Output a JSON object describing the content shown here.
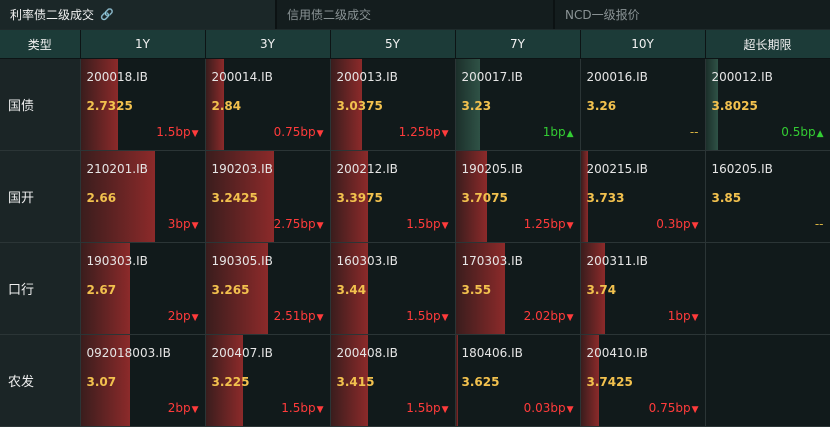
{
  "tabs": [
    {
      "label": "利率债二级成交",
      "active": true
    },
    {
      "label": "信用债二级成交",
      "active": false
    },
    {
      "label": "NCD一级报价",
      "active": false
    }
  ],
  "columns": [
    "类型",
    "1Y",
    "3Y",
    "5Y",
    "7Y",
    "10Y",
    "超长期限"
  ],
  "rows": [
    {
      "type": "国债",
      "cells": [
        {
          "code": "200018.IB",
          "yield": "2.7325",
          "change": "1.5bp",
          "dir": "down",
          "bar": 0.3
        },
        {
          "code": "200014.IB",
          "yield": "2.84",
          "change": "0.75bp",
          "dir": "down",
          "bar": 0.15
        },
        {
          "code": "200013.IB",
          "yield": "3.0375",
          "change": "1.25bp",
          "dir": "down",
          "bar": 0.25
        },
        {
          "code": "200017.IB",
          "yield": "3.23",
          "change": "1bp",
          "dir": "up",
          "bar": 0.2
        },
        {
          "code": "200016.IB",
          "yield": "3.26",
          "change": "--",
          "dir": "none",
          "bar": 0
        },
        {
          "code": "200012.IB",
          "yield": "3.8025",
          "change": "0.5bp",
          "dir": "up",
          "bar": 0.1
        }
      ]
    },
    {
      "type": "国开",
      "cells": [
        {
          "code": "210201.IB",
          "yield": "2.66",
          "change": "3bp",
          "dir": "down",
          "bar": 0.6
        },
        {
          "code": "190203.IB",
          "yield": "3.2425",
          "change": "2.75bp",
          "dir": "down",
          "bar": 0.55
        },
        {
          "code": "200212.IB",
          "yield": "3.3975",
          "change": "1.5bp",
          "dir": "down",
          "bar": 0.3
        },
        {
          "code": "190205.IB",
          "yield": "3.7075",
          "change": "1.25bp",
          "dir": "down",
          "bar": 0.25
        },
        {
          "code": "200215.IB",
          "yield": "3.733",
          "change": "0.3bp",
          "dir": "down",
          "bar": 0.06
        },
        {
          "code": "160205.IB",
          "yield": "3.85",
          "change": "--",
          "dir": "none",
          "bar": 0
        }
      ]
    },
    {
      "type": "口行",
      "cells": [
        {
          "code": "190303.IB",
          "yield": "2.67",
          "change": "2bp",
          "dir": "down",
          "bar": 0.4
        },
        {
          "code": "190305.IB",
          "yield": "3.265",
          "change": "2.51bp",
          "dir": "down",
          "bar": 0.5
        },
        {
          "code": "160303.IB",
          "yield": "3.44",
          "change": "1.5bp",
          "dir": "down",
          "bar": 0.3
        },
        {
          "code": "170303.IB",
          "yield": "3.55",
          "change": "2.02bp",
          "dir": "down",
          "bar": 0.4
        },
        {
          "code": "200311.IB",
          "yield": "3.74",
          "change": "1bp",
          "dir": "down",
          "bar": 0.2
        },
        null
      ]
    },
    {
      "type": "农发",
      "cells": [
        {
          "code": "092018003.IB",
          "yield": "3.07",
          "change": "2bp",
          "dir": "down",
          "bar": 0.4
        },
        {
          "code": "200407.IB",
          "yield": "3.225",
          "change": "1.5bp",
          "dir": "down",
          "bar": 0.3
        },
        {
          "code": "200408.IB",
          "yield": "3.415",
          "change": "1.5bp",
          "dir": "down",
          "bar": 0.3
        },
        {
          "code": "180406.IB",
          "yield": "3.625",
          "change": "0.03bp",
          "dir": "down",
          "bar": 0.02
        },
        {
          "code": "200410.IB",
          "yield": "3.7425",
          "change": "0.75bp",
          "dir": "down",
          "bar": 0.15
        },
        null
      ]
    }
  ]
}
